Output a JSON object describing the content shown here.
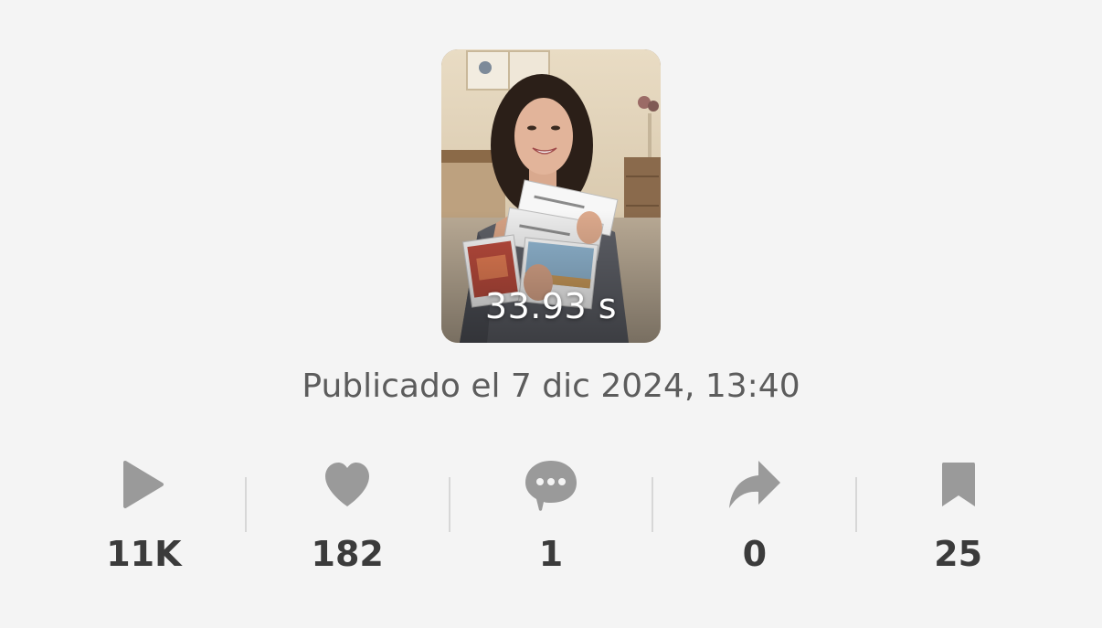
{
  "video": {
    "duration_label": "33.93 s"
  },
  "published": {
    "text": "Publicado el 7 dic 2024, 13:40"
  },
  "stats": [
    {
      "icon": "play-icon",
      "value": "11K"
    },
    {
      "icon": "heart-icon",
      "value": "182"
    },
    {
      "icon": "comment-icon",
      "value": "1"
    },
    {
      "icon": "share-icon",
      "value": "0"
    },
    {
      "icon": "bookmark-icon",
      "value": "25"
    }
  ],
  "colors": {
    "background": "#f4f4f4",
    "icon": "#9a9a9a",
    "value_text": "#3b3b3b",
    "meta_text": "#5c5c5c",
    "divider": "#d7d7d7"
  }
}
